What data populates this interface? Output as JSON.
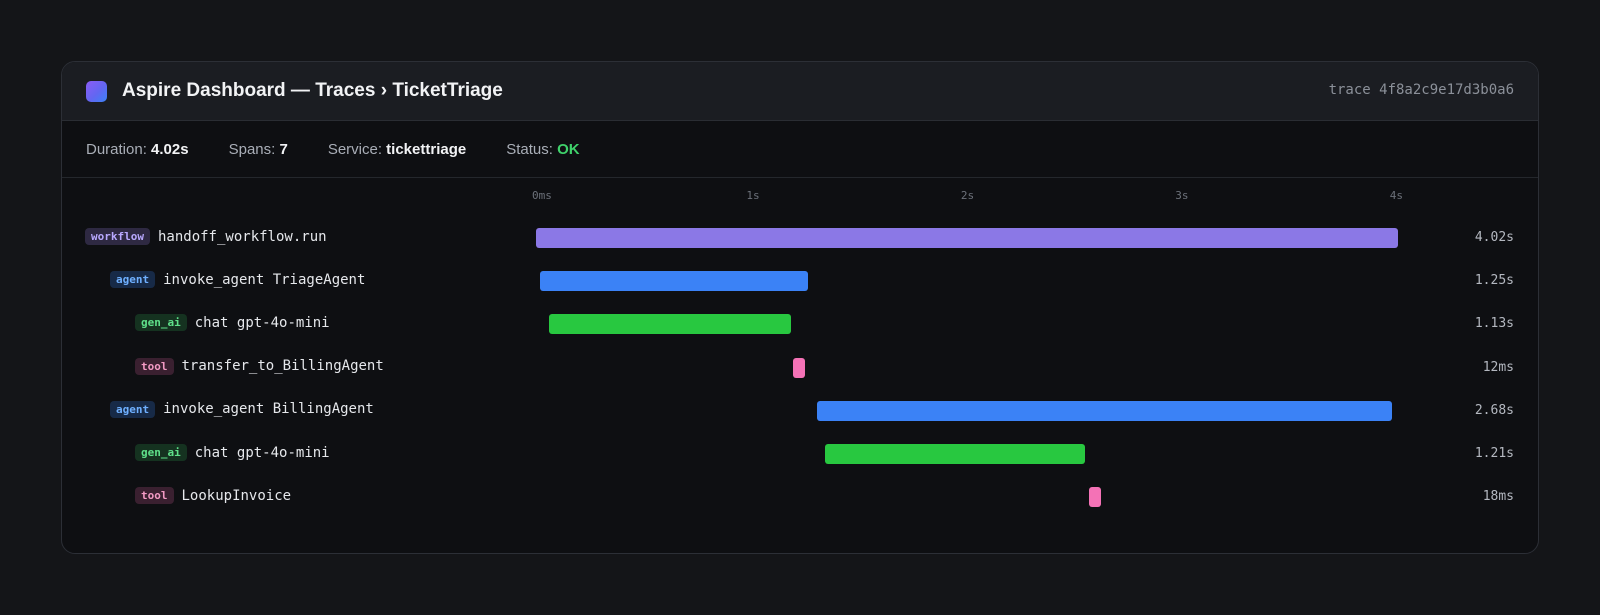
{
  "header": {
    "title": "Aspire Dashboard — Traces › TicketTriage",
    "trace_id": "trace 4f8a2c9e17d3b0a6",
    "logo_icon": "aspire-logo-icon"
  },
  "stats": {
    "duration_label": "Duration:",
    "duration_value": "4.02s",
    "spans_label": "Spans:",
    "spans_value": "7",
    "service_label": "Service:",
    "service_value": "tickettriage",
    "status_label": "Status:",
    "status_value": "OK"
  },
  "colors": {
    "workflow": "#8b78e6",
    "agent": "#3b82f6",
    "gen_ai": "#28c840",
    "tool": "#f472b6",
    "status_ok": "#3fd26b"
  },
  "chart_data": {
    "type": "gantt",
    "x_unit": "s",
    "xlim": [
      0,
      4.02
    ],
    "ticks": [
      {
        "value": 0,
        "label": "0ms"
      },
      {
        "value": 1,
        "label": "1s"
      },
      {
        "value": 2,
        "label": "2s"
      },
      {
        "value": 3,
        "label": "3s"
      },
      {
        "value": 4,
        "label": "4s"
      }
    ],
    "spans": [
      {
        "kind": "workflow",
        "name": "handoff_workflow.run",
        "depth": 0,
        "start": 0.0,
        "duration": 4.02,
        "duration_label": "4.02s"
      },
      {
        "kind": "agent",
        "name": "invoke_agent TriageAgent",
        "depth": 1,
        "start": 0.02,
        "duration": 1.25,
        "duration_label": "1.25s"
      },
      {
        "kind": "gen_ai",
        "name": "chat gpt-4o-mini",
        "depth": 2,
        "start": 0.06,
        "duration": 1.13,
        "duration_label": "1.13s"
      },
      {
        "kind": "tool",
        "name": "transfer_to_BillingAgent",
        "depth": 2,
        "start": 1.2,
        "duration": 0.012,
        "duration_label": "12ms"
      },
      {
        "kind": "agent",
        "name": "invoke_agent BillingAgent",
        "depth": 1,
        "start": 1.31,
        "duration": 2.68,
        "duration_label": "2.68s"
      },
      {
        "kind": "gen_ai",
        "name": "chat gpt-4o-mini",
        "depth": 2,
        "start": 1.35,
        "duration": 1.21,
        "duration_label": "1.21s"
      },
      {
        "kind": "tool",
        "name": "LookupInvoice",
        "depth": 2,
        "start": 2.58,
        "duration": 0.018,
        "duration_label": "18ms"
      }
    ]
  }
}
